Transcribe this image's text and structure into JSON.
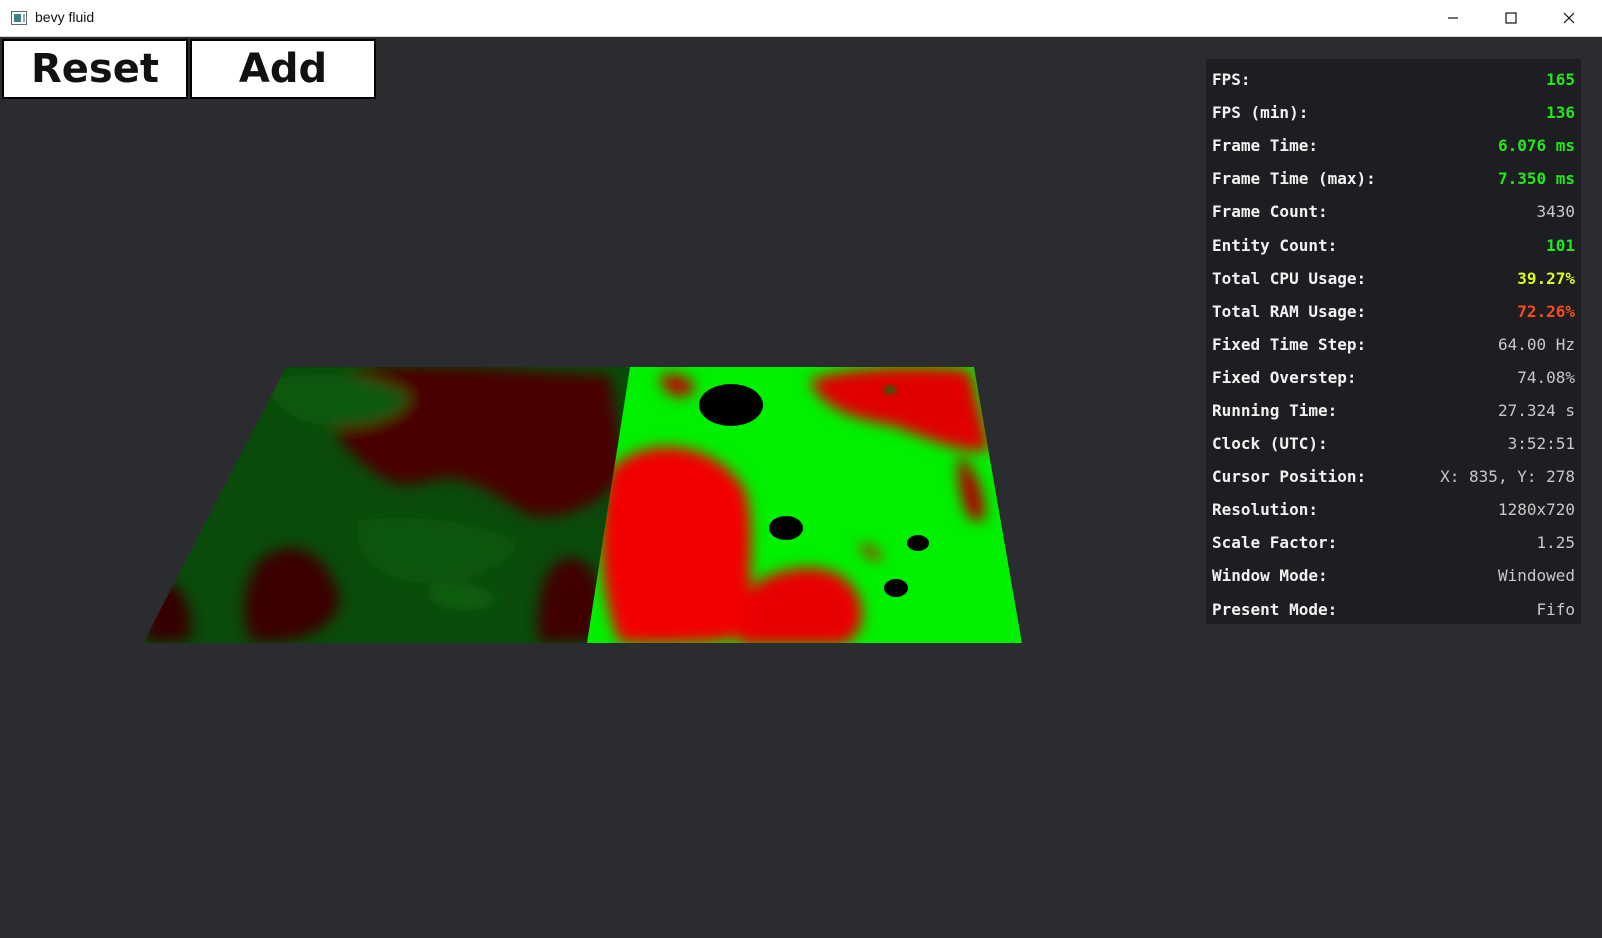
{
  "window": {
    "title": "bevy fluid",
    "controls": [
      "minimize",
      "maximize",
      "close"
    ]
  },
  "buttons": {
    "reset_label": "Reset",
    "add_label": "Add"
  },
  "colors": {
    "background": "#2b2c30",
    "fluid_green": "#00ff00",
    "fluid_red": "#ff0000",
    "stat_good": "#22e81c",
    "stat_warn": "#d7ff1a",
    "stat_bad": "#ff4a1a",
    "stat_neutral": "#c8c8c8"
  },
  "stats": [
    {
      "label": "FPS:",
      "value": "165",
      "color": "#22e81c",
      "bold": true
    },
    {
      "label": "FPS (min):",
      "value": "136",
      "color": "#22e81c",
      "bold": true
    },
    {
      "label": "Frame Time:",
      "value": "6.076 ms",
      "color": "#22e81c",
      "bold": true
    },
    {
      "label": "Frame Time (max):",
      "value": "7.350 ms",
      "color": "#22e81c",
      "bold": true
    },
    {
      "label": "Frame Count:",
      "value": "3430",
      "color": "#c8c8c8",
      "bold": false
    },
    {
      "label": "Entity Count:",
      "value": "101",
      "color": "#22e81c",
      "bold": true
    },
    {
      "label": "Total CPU Usage:",
      "value": "39.27%",
      "color": "#d7ff1a",
      "bold": true
    },
    {
      "label": "Total RAM Usage:",
      "value": "72.26%",
      "color": "#ff4a1a",
      "bold": true
    },
    {
      "label": "Fixed Time Step:",
      "value": "64.00 Hz",
      "color": "#c8c8c8",
      "bold": false
    },
    {
      "label": "Fixed Overstep:",
      "value": "74.08%",
      "color": "#c8c8c8",
      "bold": false
    },
    {
      "label": "Running Time:",
      "value": "27.324 s",
      "color": "#c8c8c8",
      "bold": false
    },
    {
      "label": "Clock (UTC):",
      "value": "3:52:51",
      "color": "#c8c8c8",
      "bold": false
    },
    {
      "label": "Cursor Position:",
      "value": "X: 835, Y: 278",
      "color": "#c8c8c8",
      "bold": false
    },
    {
      "label": "Resolution:",
      "value": "1280x720",
      "color": "#c8c8c8",
      "bold": false
    },
    {
      "label": "Scale Factor:",
      "value": "1.25",
      "color": "#c8c8c8",
      "bold": false
    },
    {
      "label": "Window Mode:",
      "value": "Windowed",
      "color": "#c8c8c8",
      "bold": false
    },
    {
      "label": "Present Mode:",
      "value": "Fifo",
      "color": "#c8c8c8",
      "bold": false
    }
  ]
}
